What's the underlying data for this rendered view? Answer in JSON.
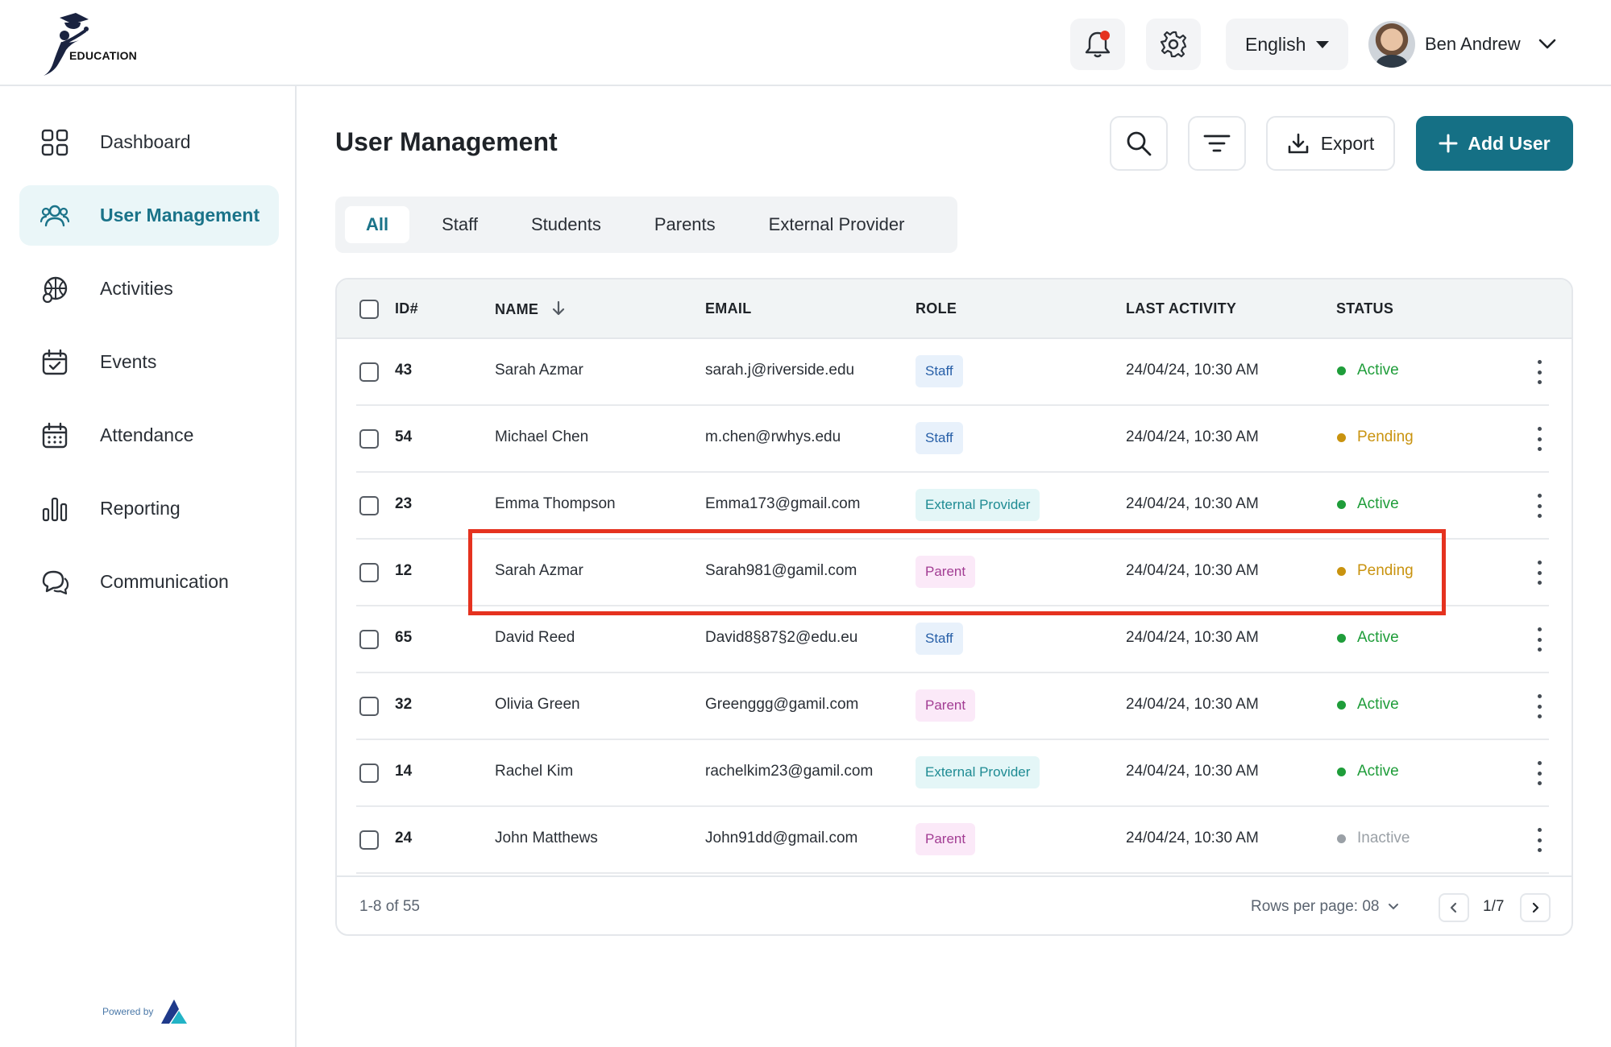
{
  "brand": {
    "logo_text": "EDUCATION",
    "powered_by": "Powered by"
  },
  "header": {
    "language": "English",
    "user_name": "Ben Andrew",
    "notification_color": "#e5321f"
  },
  "sidebar": {
    "items": [
      {
        "label": "Dashboard",
        "icon": "grid-icon",
        "active": false
      },
      {
        "label": "User Management",
        "icon": "users-icon",
        "active": true
      },
      {
        "label": "Activities",
        "icon": "basketball-icon",
        "active": false
      },
      {
        "label": "Events",
        "icon": "calendar-check-icon",
        "active": false
      },
      {
        "label": "Attendance",
        "icon": "calendar-icon",
        "active": false
      },
      {
        "label": "Reporting",
        "icon": "bar-chart-icon",
        "active": false
      },
      {
        "label": "Communication",
        "icon": "chat-icon",
        "active": false
      }
    ]
  },
  "main": {
    "title": "User Management",
    "export_label": "Export",
    "add_user_label": "Add User",
    "tabs": [
      "All",
      "Staff",
      "Students",
      "Parents",
      "External Provider"
    ],
    "active_tab": "All",
    "columns": [
      "ID#",
      "NAME",
      "EMAIL",
      "ROLE",
      "LAST ACTIVITY",
      "STATUS"
    ],
    "rows": [
      {
        "id": "43",
        "name": "Sarah Azmar",
        "email": "sarah.j@riverside.edu",
        "role": "Staff",
        "last_activity": "24/04/24, 10:30 AM",
        "status": "Active"
      },
      {
        "id": "54",
        "name": "Michael Chen",
        "email": "m.chen@rwhys.edu",
        "role": "Staff",
        "last_activity": "24/04/24, 10:30 AM",
        "status": "Pending"
      },
      {
        "id": "23",
        "name": "Emma Thompson",
        "email": "Emma173@gmail.com",
        "role": "External Provider",
        "last_activity": "24/04/24, 10:30 AM",
        "status": "Active"
      },
      {
        "id": "12",
        "name": "Sarah Azmar",
        "email": "Sarah981@gamil.com",
        "role": "Parent",
        "last_activity": "24/04/24, 10:30 AM",
        "status": "Pending"
      },
      {
        "id": "65",
        "name": "David Reed",
        "email": "David8§87§2@edu.eu",
        "role": "Staff",
        "last_activity": "24/04/24, 10:30 AM",
        "status": "Active"
      },
      {
        "id": "32",
        "name": "Olivia Green",
        "email": "Greenggg@gamil.com",
        "role": "Parent",
        "last_activity": "24/04/24, 10:30 AM",
        "status": "Active"
      },
      {
        "id": "14",
        "name": "Rachel Kim",
        "email": "rachelkim23@gamil.com",
        "role": "External Provider",
        "last_activity": "24/04/24, 10:30 AM",
        "status": "Active"
      },
      {
        "id": "24",
        "name": "John Matthews",
        "email": "John91dd@gmail.com",
        "role": "Parent",
        "last_activity": "24/04/24, 10:30 AM",
        "status": "Inactive"
      }
    ],
    "pagination": {
      "range": "1-8 of 55",
      "rows_per_page": "Rows per page: 08",
      "page": "1/7"
    }
  },
  "colors": {
    "accent": "#157085",
    "active_status": "#1f9d3a",
    "pending_status": "#c9930f",
    "inactive_status": "#9aa0a6",
    "highlight_box": "#e5321f"
  }
}
